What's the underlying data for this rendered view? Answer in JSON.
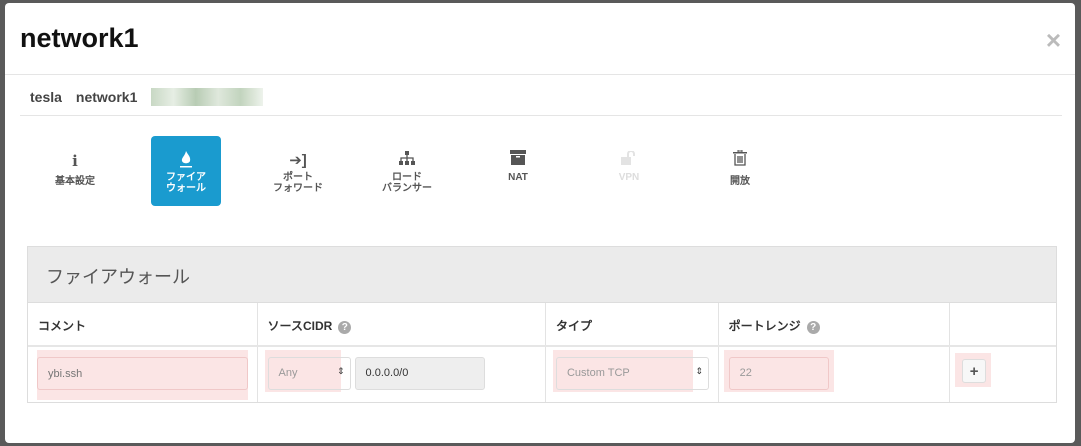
{
  "modal": {
    "title": "network1",
    "close": "×"
  },
  "breadcrumb": {
    "items": [
      "tesla",
      "network1"
    ]
  },
  "nav": {
    "items": [
      {
        "icon": "info-icon",
        "glyph": "i",
        "label": "基本設定"
      },
      {
        "icon": "fire-icon",
        "glyph": "🔥",
        "label": "ファイア\nウォール",
        "active": true
      },
      {
        "icon": "sign-in-icon",
        "glyph": "⇥",
        "label": "ポート\nフォワード"
      },
      {
        "icon": "sitemap-icon",
        "glyph": "⊥",
        "label": "ロード\nバランサー"
      },
      {
        "icon": "archive-icon",
        "glyph": "▣",
        "label": "NAT"
      },
      {
        "icon": "unlock-icon",
        "glyph": "🔓",
        "label": "VPN",
        "disabled": true
      },
      {
        "icon": "trash-icon",
        "glyph": "🗑",
        "label": "開放"
      }
    ]
  },
  "panel": {
    "title": "ファイアウォール",
    "columns": [
      "コメント",
      "ソースCIDR",
      "タイプ",
      "ポートレンジ",
      ""
    ],
    "help": "?",
    "row": {
      "comment_placeholder": "ybi.ssh",
      "source_select": "Any",
      "cidr": "0.0.0.0/0",
      "type": "Custom TCP",
      "port": "22",
      "add": "+"
    }
  }
}
